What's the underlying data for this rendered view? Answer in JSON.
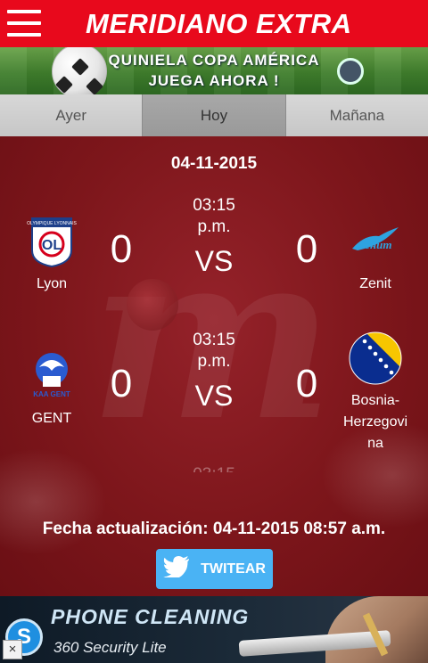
{
  "header": {
    "title": "MERIDIANO EXTRA"
  },
  "promo": {
    "line1": "QUINIELA COPA AMÉRICA",
    "line2": "JUEGA AHORA !"
  },
  "tabs": [
    {
      "label": "Ayer",
      "active": false
    },
    {
      "label": "Hoy",
      "active": true
    },
    {
      "label": "Mañana",
      "active": false
    }
  ],
  "date": "04-11-2015",
  "matches": [
    {
      "time_line1": "03:15",
      "time_line2": "p.m.",
      "vs": "VS",
      "home": {
        "name": "Lyon",
        "score": "0",
        "logo": "lyon-crest"
      },
      "away": {
        "name": "Zenit",
        "score": "0",
        "logo": "zenit-crest"
      }
    },
    {
      "time_line1": "03:15",
      "time_line2": "p.m.",
      "vs": "VS",
      "home": {
        "name": "GENT",
        "score": "0",
        "logo": "gent-crest",
        "crest_text": "KAA GENT"
      },
      "away": {
        "name_line1": "Bosnia-",
        "name_line2": "Herzegovi",
        "name_line3": "na",
        "score": "0",
        "logo": "bosnia-flag"
      }
    }
  ],
  "updated": "Fecha actualización: 04-11-2015 08:57 a.m.",
  "tweet_label": "TWITEAR",
  "ad": {
    "title": "PHONE CLEANING",
    "subtitle": "360 Security Lite",
    "close": "×",
    "icon_letter": "S"
  },
  "lyon_crest_text": "OLYMPIQUE LYONNAIS",
  "colors": {
    "header_red": "#e8091c",
    "main_red": "#7d161b",
    "twitter_blue": "#4ab3f4",
    "tab_gray": "#cfcfcf"
  }
}
